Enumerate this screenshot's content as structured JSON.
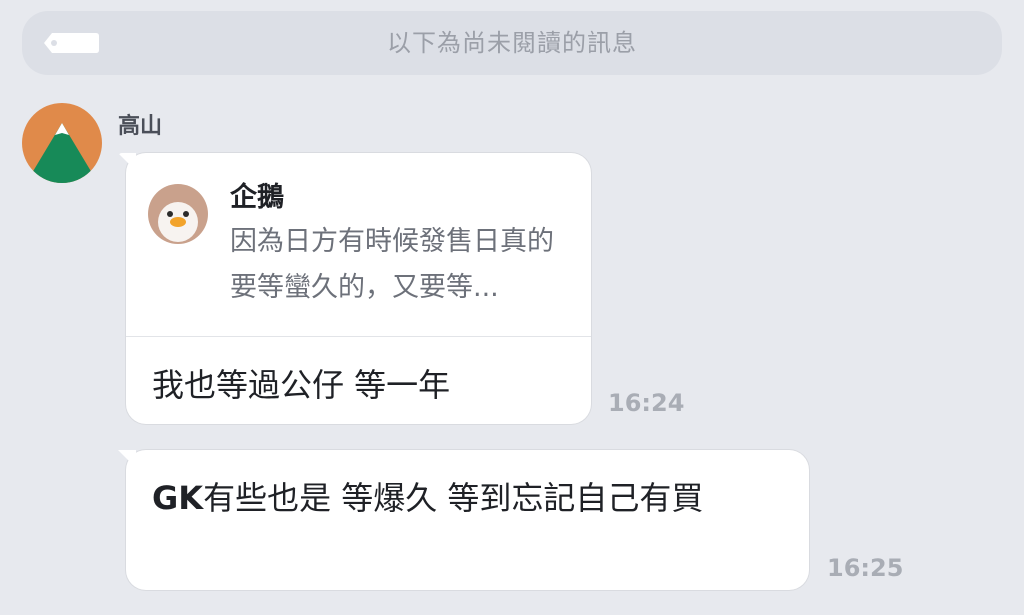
{
  "banner": {
    "text": "以下為尚未閱讀的訊息",
    "icon": "tag-icon"
  },
  "messages": [
    {
      "sender": "高山",
      "avatar": "mountain-avatar",
      "quote": {
        "author": "企鵝",
        "author_avatar": "penguin-avatar",
        "text": "因為日方有時候發售日真的要等蠻久的，又要等..."
      },
      "text": "我也等過公仔 等一年",
      "time": "16:24"
    },
    {
      "text_prefix": "GK",
      "text_rest": "有些也是 等爆久 等到忘記自己有買",
      "time": "16:25"
    }
  ],
  "colors": {
    "background": "#e7e9ee",
    "banner_bg": "#dcdfe6",
    "bubble_bg": "#ffffff",
    "avatar_orange": "#e08a4a",
    "avatar_green": "#178a58"
  }
}
